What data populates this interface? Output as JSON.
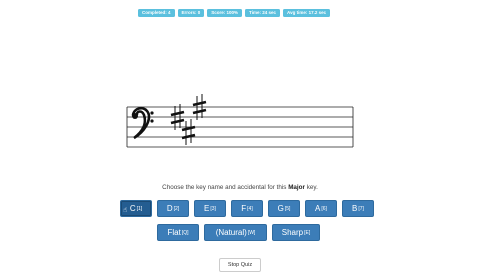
{
  "stats": [
    {
      "label": "Completed: 4"
    },
    {
      "label": "Errors: 0"
    },
    {
      "label": "Score: 100%"
    },
    {
      "label": "Time: 24 sec"
    },
    {
      "label": "Avg time: 17.2 sec"
    }
  ],
  "staff": {
    "clef": "bass-clef-icon",
    "accidentals": [
      "sharp",
      "sharp",
      "sharp"
    ]
  },
  "question": {
    "prefix": "Choose the key name and accidental for this ",
    "mode": "Major",
    "suffix": " key."
  },
  "keys": [
    {
      "label": "C",
      "shortcut": "[1]",
      "active": true
    },
    {
      "label": "D",
      "shortcut": "[2]"
    },
    {
      "label": "E",
      "shortcut": "[3]"
    },
    {
      "label": "F",
      "shortcut": "[4]"
    },
    {
      "label": "G",
      "shortcut": "[5]"
    },
    {
      "label": "A",
      "shortcut": "[6]"
    },
    {
      "label": "B",
      "shortcut": "[7]"
    }
  ],
  "accidentals": [
    {
      "label": "Flat",
      "shortcut": "[Q]"
    },
    {
      "label": "(Natural)",
      "shortcut": "[W]"
    },
    {
      "label": "Sharp",
      "shortcut": "[E]"
    }
  ],
  "stop_label": "Stop Quiz",
  "colors": {
    "badge": "#5bc0de",
    "button": "#3c7db8"
  }
}
